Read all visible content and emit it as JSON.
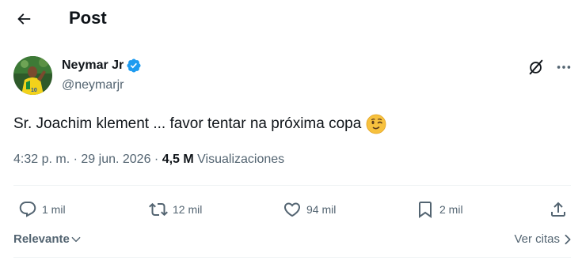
{
  "header": {
    "title": "Post",
    "back_icon": "arrow-left-icon"
  },
  "author": {
    "name": "Neymar Jr",
    "handle": "@neymarjr",
    "verified": true,
    "verified_color": "#1d9bf0"
  },
  "post": {
    "text": "Sr. Joachim klement ... favor tentar na próxima copa",
    "emoji": "winking-face-emoji",
    "time": "4:32 p. m.",
    "separator": "·",
    "date": "29 jun. 2026",
    "views_count": "4,5 M",
    "views_label": "Visualizaciones"
  },
  "actions": {
    "replies": "1 mil",
    "reposts": "12 mil",
    "likes": "94 mil",
    "bookmarks": "2 mil"
  },
  "footer": {
    "sort_label": "Relevante",
    "quotes_label": "Ver citas"
  },
  "colors": {
    "text": "#0f1419",
    "secondary": "#536471",
    "divider": "#eff3f4",
    "accent": "#1d9bf0"
  }
}
